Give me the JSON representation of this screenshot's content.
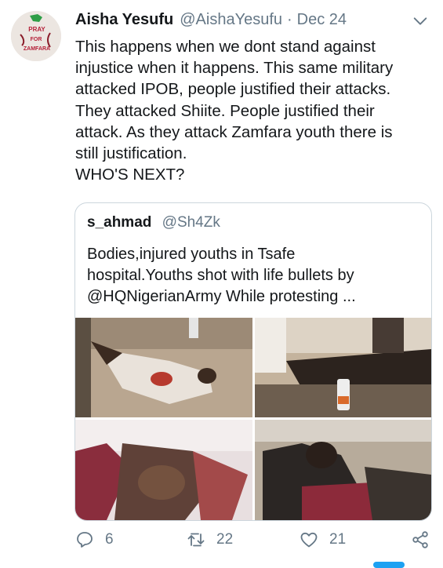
{
  "tweet": {
    "author_name": "Aisha Yesufu",
    "author_handle": "@AishaYesufu",
    "separator": "·",
    "date": "Dec 24",
    "avatar_text": [
      "PRAY",
      "FOR",
      "ZAMFARA"
    ],
    "text_lines": [
      "This happens when we dont stand against",
      "injustice when it happens. This same military",
      "attacked IPOB, people justified their attacks.",
      "They attacked Shiite. People justified their",
      "attack. As they attack Zamfara youth there is",
      "still justification.",
      "WHO'S NEXT?"
    ]
  },
  "quoted_tweet": {
    "author_name": "s_ahmad",
    "author_handle": "@Sh4Zk",
    "text_lines": [
      "Bodies,injured youths in Tsafe",
      "hospital.Youths shot with life bullets by",
      "@HQNigerianArmy While  protesting ..."
    ],
    "media": [
      "photo-1",
      "photo-2",
      "photo-3",
      "photo-4"
    ]
  },
  "actions": {
    "reply_count": "6",
    "retweet_count": "22",
    "like_count": "21"
  },
  "icons": {
    "menu": "chevron-down-icon",
    "reply": "reply-icon",
    "retweet": "retweet-icon",
    "like": "heart-icon",
    "share": "share-icon"
  },
  "colors": {
    "text": "#14171a",
    "secondary": "#657786",
    "border": "#ccd6dd",
    "accent": "#1da1f2"
  }
}
